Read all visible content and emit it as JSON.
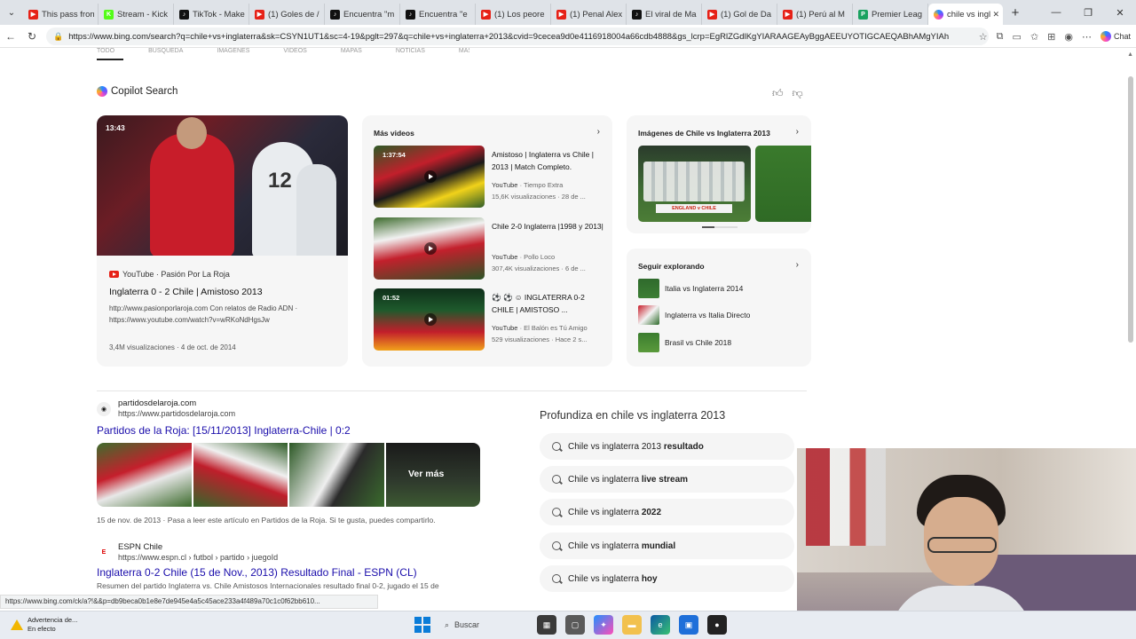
{
  "browser": {
    "tabs": [
      {
        "title": "This pass fron",
        "color": "#e62117",
        "glyph": "▶",
        "active": false
      },
      {
        "title": "Stream - Kick",
        "color": "#53fc18",
        "glyph": "K",
        "active": false
      },
      {
        "title": "TikTok - Make",
        "color": "#111111",
        "glyph": "♪",
        "active": false
      },
      {
        "title": "(1) Goles de /",
        "color": "#e62117",
        "glyph": "▶",
        "active": false
      },
      {
        "title": "Encuentra \"m",
        "color": "#111111",
        "glyph": "♪",
        "active": false
      },
      {
        "title": "Encuentra \"e",
        "color": "#111111",
        "glyph": "♪",
        "active": false
      },
      {
        "title": "(1) Los peore",
        "color": "#e62117",
        "glyph": "▶",
        "active": false
      },
      {
        "title": "(1) Penal Alex",
        "color": "#e62117",
        "glyph": "▶",
        "active": false
      },
      {
        "title": "El viral de Ma",
        "color": "#111111",
        "glyph": "♪",
        "active": false
      },
      {
        "title": "(1) Gol de Da",
        "color": "#e62117",
        "glyph": "▶",
        "active": false
      },
      {
        "title": "(1) Perú al M",
        "color": "#e62117",
        "glyph": "▶",
        "active": false
      },
      {
        "title": "Premier Leag",
        "color": "#1aa260",
        "glyph": "P",
        "active": false
      },
      {
        "title": "chile vs ingla",
        "color": "#ffffff",
        "glyph": "",
        "active": true
      }
    ],
    "new_tab": "+",
    "url": "https://www.bing.com/search?q=chile+vs+inglaterra+2013&qs=n&form=QBRE&sp=-1&lq=0&pq=chile+vs+inglaterra&sc=4-19&sk=&cvid=...",
    "url_shown": "https://www.bing.com/search?q=chile+vs+inglaterra&sk=CSYN1UT1&sc=4-19&pglt=297&q=chile+vs+inglaterra+2013&cvid=9cecea9d0e4116918004a66cdb4888&gs_lcrp=EgRlZGdlKgYIARAAGEAyBggAEEUYOTIGCAEQABhAMgYIAh",
    "chat_label": "Chat"
  },
  "page": {
    "scopes": [
      "TODO",
      "BÚSQUEDA",
      "IMÁGENES",
      "VIDEOS",
      "MAPAS",
      "NOTICIAS",
      "MÁS"
    ],
    "copilot_label": "Copilot Search",
    "main_video": {
      "duration": "13:43",
      "source": "YouTube · Pasión Por La Roja",
      "title": "Inglaterra 0 - 2 Chile | Amistoso 2013",
      "desc1": "http://www.pasionporlaroja.com Con relatos de Radio ADN ·",
      "desc2": "https://www.youtube.com/watch?v=wRKoNdHgsJw",
      "meta": "3,4M visualizaciones · 4 de oct. de 2014",
      "jersey_num": "12"
    },
    "more_videos": {
      "heading": "Más videos",
      "items": [
        {
          "duration": "1:37:54",
          "title": "Amistoso | Inglaterra vs Chile | 2013 | Match Completo.",
          "src_name": "YouTube",
          "src_rest": " · Tiempo Extra",
          "stats": "15,6K visualizaciones · 28 de ..."
        },
        {
          "duration": "",
          "title": "Chile 2-0 Inglaterra |1998 y 2013|",
          "src_name": "YouTube",
          "src_rest": " · Pollo Loco",
          "stats": "307,4K visualizaciones · 6 de ..."
        },
        {
          "duration": "01:52",
          "title": "⚽ ⚽ ☺ INGLATERRA 0-2 CHILE | AMISTOSO ...",
          "src_name": "YouTube",
          "src_rest": " · El Balón es Tú Amigo",
          "stats": "529 visualizaciones · Hace 2 s..."
        }
      ]
    },
    "images": {
      "heading": "Imágenes de Chile vs Inglaterra 2013",
      "banner": "ENGLAND v CHILE"
    },
    "explore": {
      "heading": "Seguir explorando",
      "items": [
        "Italia vs Inglaterra 2014",
        "Inglaterra vs Italia Directo",
        "Brasil vs Chile 2018"
      ]
    },
    "results": [
      {
        "site": "partidosdelaroja.com",
        "url": "https://www.partidosdelaroja.com",
        "title": "Partidos de la Roja: [15/11/2013] Inglaterra-Chile | 0:2",
        "desc": "15 de nov. de 2013 · Pasa a leer este artículo en Partidos de la Roja. Si te gusta, puedes compartirlo.",
        "more": "Ver más"
      },
      {
        "site": "ESPN Chile",
        "url": "https://www.espn.cl › futbol › partido › juegoId",
        "title": "Inglaterra 0-2 Chile (15 de Nov., 2013) Resultado Final - ESPN (CL)",
        "desc": "Resumen del partido Inglaterra vs. Chile Amistosos Internacionales resultado final 0-2, jugado el 15 de"
      }
    ],
    "deep": {
      "heading": "Profundiza en chile vs inglaterra 2013",
      "chips": [
        {
          "base": "Chile vs inglaterra 2013 ",
          "bold": "resultado"
        },
        {
          "base": "Chile vs inglaterra ",
          "bold": "live stream"
        },
        {
          "base": "Chile vs inglaterra ",
          "bold": "2022"
        },
        {
          "base": "Chile vs inglaterra ",
          "bold": "mundial"
        },
        {
          "base": "Chile vs inglaterra ",
          "bold": "hoy"
        }
      ]
    },
    "status_url": "https://www.bing.com/ck/a?!&&p=db9beca0b1e8e7de945e4a5c45ace233a4f489a70c1c0f62bb610..."
  },
  "taskbar": {
    "warning_line1": "Advertencia de...",
    "warning_line2": "En efecto",
    "search_label": "Buscar"
  },
  "colors": {
    "link": "#1a0dab",
    "accent_red": "#c81d2a",
    "taskbar": "#e8ecf2"
  }
}
